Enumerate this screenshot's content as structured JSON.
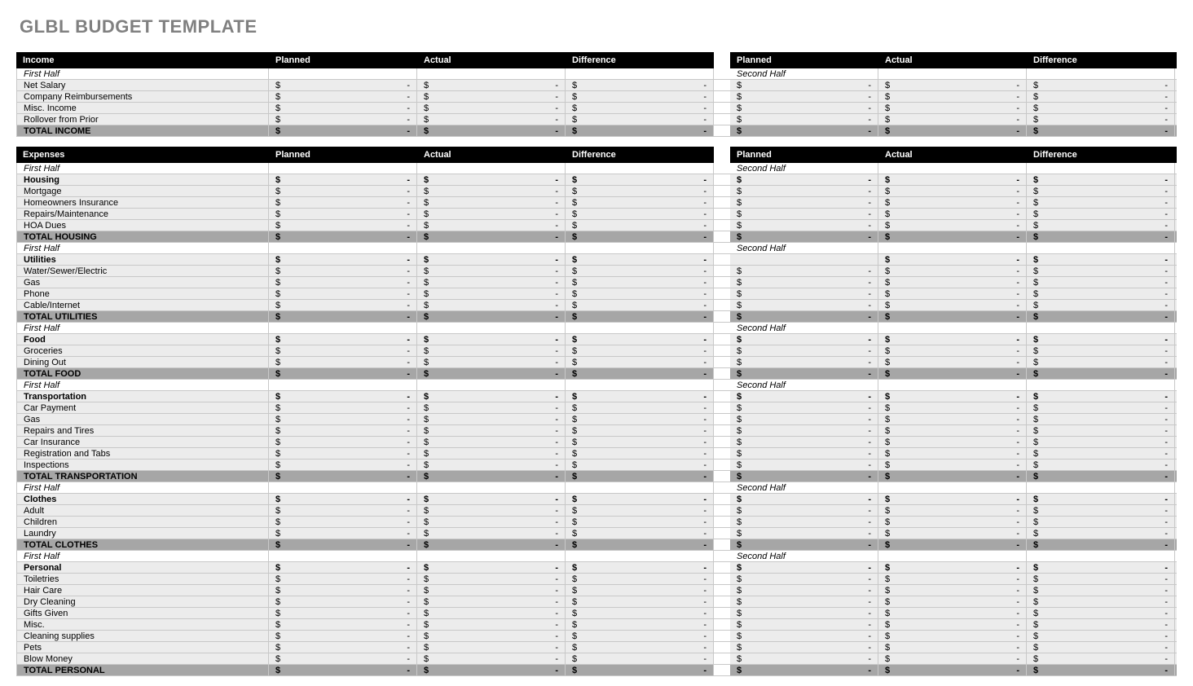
{
  "title": "GLBL BUDGET TEMPLATE",
  "columns": {
    "planned": "Planned",
    "actual": "Actual",
    "difference": "Difference"
  },
  "sub_first": "First Half",
  "sub_second": "Second Half",
  "dollar": "$",
  "dash": "-",
  "income": {
    "header": "Income",
    "rows": [
      "Net Salary",
      "Company Reimbursements",
      "Misc. Income",
      "Rollover from Prior"
    ],
    "total": "TOTAL INCOME"
  },
  "expenses_header": "Expenses",
  "groups": [
    {
      "category": "Housing",
      "rows": [
        "Mortgage",
        "Homeowners Insurance",
        "Repairs/Maintenance",
        "HOA Dues"
      ],
      "total": "TOTAL HOUSING",
      "show_sub_before_category": true
    },
    {
      "category": "Utilities",
      "rows": [
        "Water/Sewer/Electric",
        "Gas",
        "Phone",
        "Cable/Internet"
      ],
      "total": "TOTAL UTILITIES",
      "second_half_blank_first": true
    },
    {
      "category": "Food",
      "rows": [
        "Groceries",
        "Dining Out"
      ],
      "total": "TOTAL FOOD"
    },
    {
      "category": "Transportation",
      "rows": [
        "Car Payment",
        "Gas",
        "Repairs and Tires",
        "Car Insurance",
        "Registration and Tabs",
        "Inspections"
      ],
      "total": "TOTAL TRANSPORTATION"
    },
    {
      "category": "Clothes",
      "rows": [
        "Adult",
        "Children",
        "Laundry"
      ],
      "total": "TOTAL CLOTHES"
    },
    {
      "category": "Personal",
      "rows": [
        "Toiletries",
        "Hair Care",
        "Dry Cleaning",
        "Gifts Given",
        "Misc.",
        "Cleaning supplies",
        "Pets",
        "Blow Money"
      ],
      "total": "TOTAL PERSONAL"
    }
  ]
}
